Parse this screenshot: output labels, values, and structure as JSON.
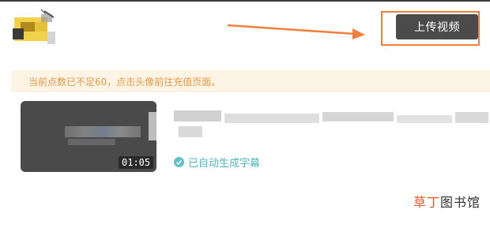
{
  "header": {
    "upload_label": "上传视频"
  },
  "notice": {
    "text": "当前点数已不足60，点击头像前往充值页面。"
  },
  "video": {
    "duration": "01:05",
    "subtitle_status": "已自动生成字幕"
  },
  "watermark": {
    "accent": "草丁",
    "rest": "图书馆"
  },
  "colors": {
    "accent_orange": "#f0803c",
    "notice_text": "#e99a45",
    "notice_bg": "#fdf4e6",
    "status_teal": "#4fb7c1",
    "button_bg": "#4b4b4b"
  }
}
